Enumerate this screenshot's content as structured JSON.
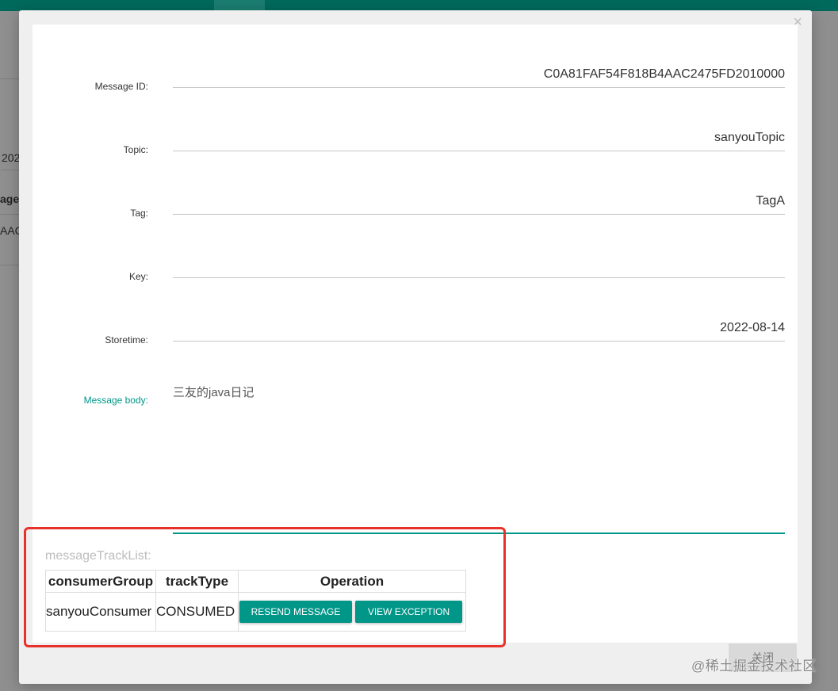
{
  "background": {
    "fragments": [
      "202",
      "age",
      "AAC"
    ]
  },
  "modal": {
    "close_glyph": "×",
    "fields": [
      {
        "label": "Message ID:",
        "value": "C0A81FAF54F818B4AAC2475FD2010000"
      },
      {
        "label": "Topic:",
        "value": "sanyouTopic"
      },
      {
        "label": "Tag:",
        "value": "TagA"
      },
      {
        "label": "Key:",
        "value": ""
      },
      {
        "label": "Storetime:",
        "value": "2022-08-14"
      }
    ],
    "message_body": {
      "label": "Message body:",
      "value": "三友的java日记"
    },
    "track_list": {
      "title": "messageTrackList:",
      "headers": [
        "consumerGroup",
        "trackType",
        "Operation"
      ],
      "rows": [
        {
          "consumer_group": "sanyouConsumer",
          "track_type": "CONSUMED",
          "resend_label": "RESEND MESSAGE",
          "exception_label": "VIEW EXCEPTION"
        }
      ]
    },
    "footer": {
      "close_label": "关闭"
    }
  },
  "watermark": "@稀土掘金技术社区",
  "colors": {
    "accent": "#009688",
    "topbar": "#00695c",
    "highlight": "#e8312a"
  }
}
